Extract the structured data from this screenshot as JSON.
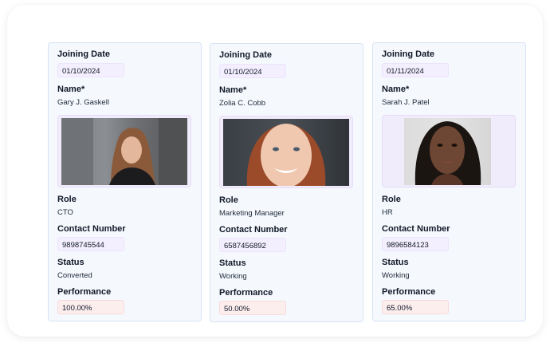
{
  "labels": {
    "joining_date": "Joining Date",
    "name": "Name*",
    "role": "Role",
    "contact": "Contact Number",
    "status": "Status",
    "performance": "Performance"
  },
  "employees": [
    {
      "joining_date": "01/10/2024",
      "name": "Gary J. Gaskell",
      "photo_icon": "employee-photo",
      "role": "CTO",
      "contact": "9898745544",
      "status": "Converted",
      "performance": "100.00%"
    },
    {
      "joining_date": "01/10/2024",
      "name": "Zolia C. Cobb",
      "photo_icon": "employee-photo",
      "role": "Marketing Manager",
      "contact": "6587456892",
      "status": "Working",
      "performance": "50.00%"
    },
    {
      "joining_date": "01/11/2024",
      "name": "Sarah J. Patel",
      "photo_icon": "employee-photo",
      "role": "HR",
      "contact": "9896584123",
      "status": "Working",
      "performance": "65.00%"
    }
  ],
  "colors": {
    "card_bg": "#f5f9fe",
    "card_border": "#d6e3f3",
    "chip_purple": "#f4efff",
    "chip_red": "#fdeeee"
  }
}
